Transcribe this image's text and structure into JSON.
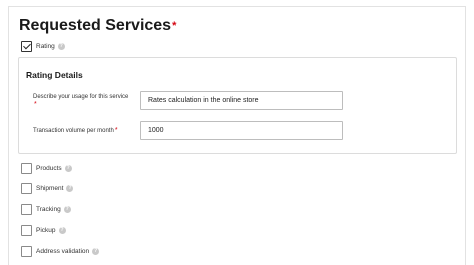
{
  "section": {
    "title": "Requested Services",
    "required_mark": "*"
  },
  "services": [
    {
      "label": "Rating",
      "checked": true
    },
    {
      "label": "Products",
      "checked": false
    },
    {
      "label": "Shipment",
      "checked": false
    },
    {
      "label": "Tracking",
      "checked": false
    },
    {
      "label": "Pickup",
      "checked": false
    },
    {
      "label": "Address validation",
      "checked": false
    }
  ],
  "info_glyph": "?",
  "rating_details": {
    "title": "Rating Details",
    "usage_label": "Describe your usage for this service",
    "usage_value": "Rates calculation in the online store",
    "volume_label": "Transaction volume per month",
    "volume_value": "1000",
    "required_mark": "*"
  },
  "colors": {
    "required": "#d40511",
    "border": "#dcdcdc",
    "info_icon": "#c9c9c9"
  }
}
